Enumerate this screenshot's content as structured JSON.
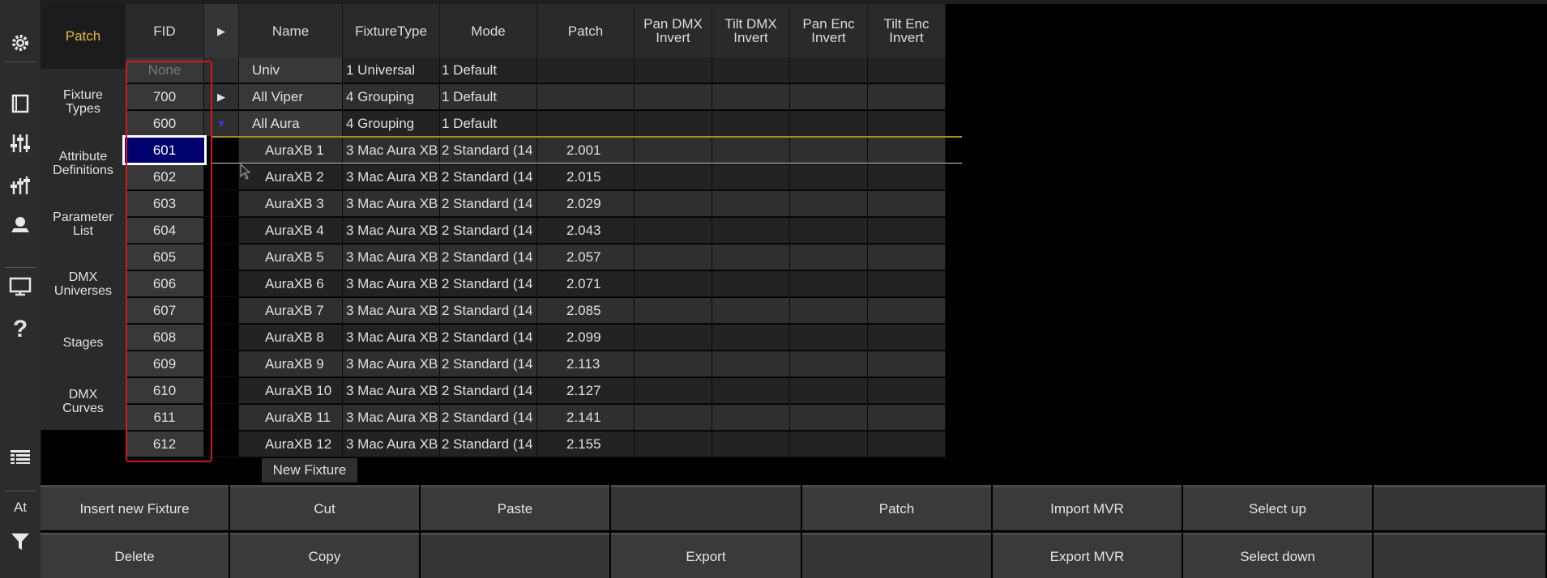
{
  "menu": {
    "title": "Patch",
    "items": [
      "Fixture\nTypes",
      "Attribute\nDefinitions",
      "Parameter\nList",
      "DMX\nUniverses",
      "Stages",
      "DMX\nCurves"
    ]
  },
  "iconbar": {
    "at_label": "At"
  },
  "table": {
    "headers": {
      "fid": "FID",
      "expand": "▶",
      "name": "Name",
      "fixture_type": "FixtureType",
      "mode": "Mode",
      "patch": "Patch",
      "pan_dmx_invert": "Pan DMX\nInvert",
      "tilt_dmx_invert": "Tilt DMX\nInvert",
      "pan_enc_invert": "Pan Enc\nInvert",
      "tilt_enc_invert": "Tilt Enc\nInvert"
    },
    "rows": [
      {
        "fid": "None",
        "arrow": "",
        "name": "Univ",
        "fixture_type": "1 Universal",
        "mode": "1 Default",
        "patch": ""
      },
      {
        "fid": "700",
        "arrow": "▶",
        "name": "All Viper",
        "fixture_type": "4 Grouping",
        "mode": "1 Default",
        "patch": ""
      },
      {
        "fid": "600",
        "arrow": "▼",
        "name": "All Aura",
        "fixture_type": "4 Grouping",
        "mode": "1 Default",
        "patch": ""
      },
      {
        "fid": "601",
        "arrow": "",
        "name": "AuraXB 1",
        "fixture_type": "3 Mac Aura XB",
        "mode": "2 Standard (14",
        "patch": "2.001"
      },
      {
        "fid": "602",
        "arrow": "",
        "name": "AuraXB 2",
        "fixture_type": "3 Mac Aura XB",
        "mode": "2 Standard (14",
        "patch": "2.015"
      },
      {
        "fid": "603",
        "arrow": "",
        "name": "AuraXB 3",
        "fixture_type": "3 Mac Aura XB",
        "mode": "2 Standard (14",
        "patch": "2.029"
      },
      {
        "fid": "604",
        "arrow": "",
        "name": "AuraXB 4",
        "fixture_type": "3 Mac Aura XB",
        "mode": "2 Standard (14",
        "patch": "2.043"
      },
      {
        "fid": "605",
        "arrow": "",
        "name": "AuraXB 5",
        "fixture_type": "3 Mac Aura XB",
        "mode": "2 Standard (14",
        "patch": "2.057"
      },
      {
        "fid": "606",
        "arrow": "",
        "name": "AuraXB 6",
        "fixture_type": "3 Mac Aura XB",
        "mode": "2 Standard (14",
        "patch": "2.071"
      },
      {
        "fid": "607",
        "arrow": "",
        "name": "AuraXB 7",
        "fixture_type": "3 Mac Aura XB",
        "mode": "2 Standard (14",
        "patch": "2.085"
      },
      {
        "fid": "608",
        "arrow": "",
        "name": "AuraXB 8",
        "fixture_type": "3 Mac Aura XB",
        "mode": "2 Standard (14",
        "patch": "2.099"
      },
      {
        "fid": "609",
        "arrow": "",
        "name": "AuraXB 9",
        "fixture_type": "3 Mac Aura XB",
        "mode": "2 Standard (14",
        "patch": "2.113"
      },
      {
        "fid": "610",
        "arrow": "",
        "name": "AuraXB 10",
        "fixture_type": "3 Mac Aura XB",
        "mode": "2 Standard (14",
        "patch": "2.127"
      },
      {
        "fid": "611",
        "arrow": "",
        "name": "AuraXB 11",
        "fixture_type": "3 Mac Aura XB",
        "mode": "2 Standard (14",
        "patch": "2.141"
      },
      {
        "fid": "612",
        "arrow": "",
        "name": "AuraXB 12",
        "fixture_type": "3 Mac Aura XB",
        "mode": "2 Standard (14",
        "patch": "2.155"
      }
    ],
    "selected_fid": "601",
    "new_fixture": "New Fixture"
  },
  "buttons": {
    "row1": [
      "Insert new Fixture",
      "Cut",
      "Paste",
      "",
      "Patch",
      "Import MVR",
      "Select up",
      ""
    ],
    "row2": [
      "Delete",
      "Copy",
      "",
      "Export",
      "",
      "Export MVR",
      "Select down",
      ""
    ]
  },
  "colors": {
    "accent": "#e6b84a",
    "selection": "#00006e",
    "outline": "#d0181d"
  }
}
